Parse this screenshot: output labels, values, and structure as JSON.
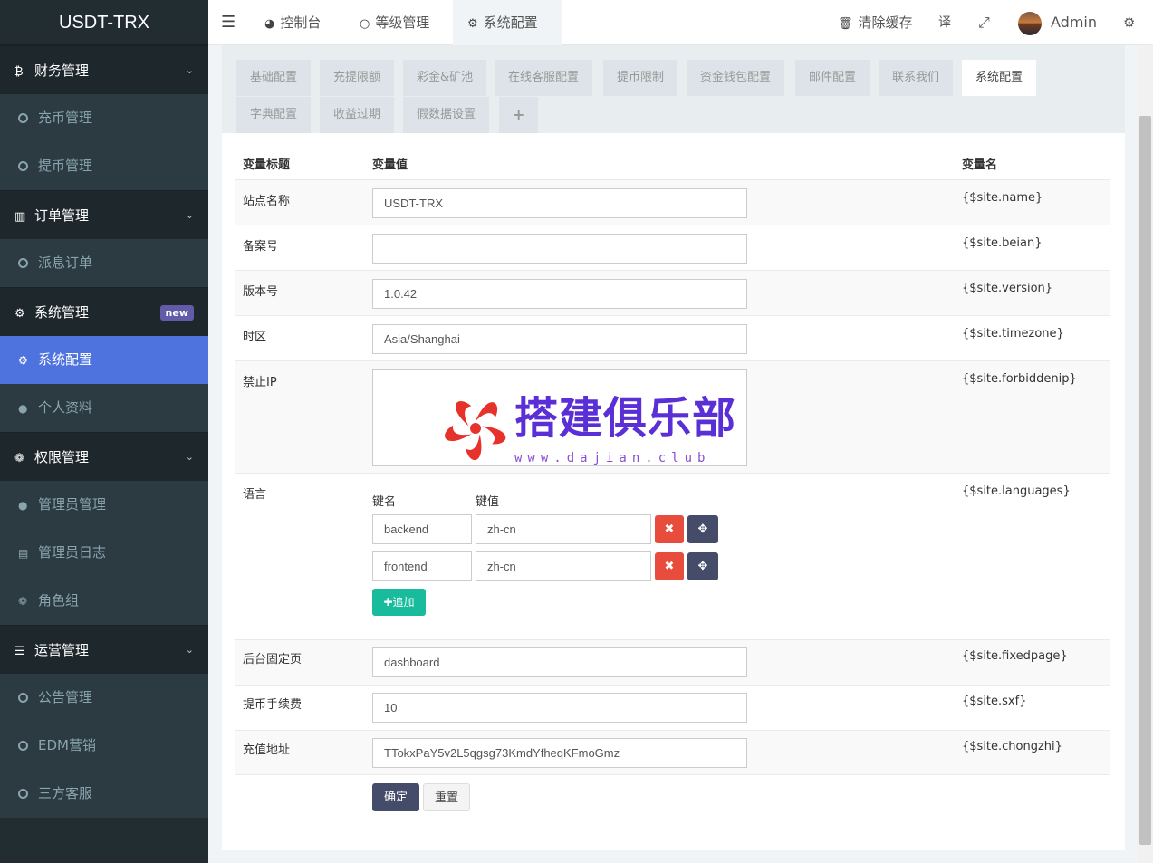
{
  "app": {
    "logo": "USDT-TRX"
  },
  "sidebar": [
    {
      "type": "header",
      "icon": "bitcoin-icon",
      "glyph": "₿",
      "label": "财务管理"
    },
    {
      "type": "item",
      "label": "充币管理"
    },
    {
      "type": "item",
      "label": "提币管理"
    },
    {
      "type": "header",
      "icon": "bar-chart-icon",
      "glyph": "▥",
      "label": "订单管理"
    },
    {
      "type": "item",
      "label": "派息订单"
    },
    {
      "type": "header",
      "icon": "gears-icon",
      "glyph": "⚙",
      "label": "系统管理",
      "badge": "new"
    },
    {
      "type": "item",
      "label": "系统配置",
      "active": true,
      "icon": "gear-icon"
    },
    {
      "type": "item",
      "label": "个人资料",
      "icon": "user-icon"
    },
    {
      "type": "header",
      "icon": "users-icon",
      "glyph": "👥",
      "label": "权限管理"
    },
    {
      "type": "item",
      "label": "管理员管理",
      "icon": "user-icon"
    },
    {
      "type": "item",
      "label": "管理员日志",
      "icon": "list-icon"
    },
    {
      "type": "item",
      "label": "角色组",
      "icon": "users-icon"
    },
    {
      "type": "header",
      "icon": "list-icon",
      "glyph": "☰",
      "label": "运营管理"
    },
    {
      "type": "item",
      "label": "公告管理"
    },
    {
      "type": "item",
      "label": "EDM营销"
    },
    {
      "type": "item",
      "label": "三方客服"
    }
  ],
  "topnav": {
    "tabs": [
      {
        "label": "控制台",
        "icon": "dashboard-icon"
      },
      {
        "label": "等级管理",
        "icon": "circle-icon"
      },
      {
        "label": "系统配置",
        "icon": "gear-icon",
        "active": true
      }
    ],
    "clear_cache": "清除缓存",
    "user": "Admin"
  },
  "config_tabs": [
    "基础配置",
    "充提限额",
    "彩金&矿池",
    "在线客服配置",
    "提币限制",
    "资金钱包配置",
    "邮件配置",
    "联系我们",
    "系统配置",
    "字典配置",
    "收益过期",
    "假数据设置",
    "+"
  ],
  "active_config_tab": "系统配置",
  "table": {
    "headers": {
      "title": "变量标题",
      "value": "变量值",
      "name": "变量名"
    },
    "rows": [
      {
        "label": "站点名称",
        "value": "USDT-TRX",
        "var": "{$site.name}"
      },
      {
        "label": "备案号",
        "value": "",
        "var": "{$site.beian}"
      },
      {
        "label": "版本号",
        "value": "1.0.42",
        "var": "{$site.version}"
      },
      {
        "label": "时区",
        "value": "Asia/Shanghai",
        "var": "{$site.timezone}"
      },
      {
        "label": "禁止IP",
        "value": "",
        "var": "{$site.forbiddenip}"
      },
      {
        "label": "语言",
        "var": "{$site.languages}"
      },
      {
        "label": "后台固定页",
        "value": "dashboard",
        "var": "{$site.fixedpage}"
      },
      {
        "label": "提币手续费",
        "value": "10",
        "var": "{$site.sxf}"
      },
      {
        "label": "充值地址",
        "value": "TTokxPaY5v2L5qgsg73KmdYfheqKFmoGmz",
        "var": "{$site.chongzhi}"
      }
    ]
  },
  "languages": {
    "key_header": "键名",
    "value_header": "键值",
    "entries": [
      {
        "key": "backend",
        "value": "zh-cn"
      },
      {
        "key": "frontend",
        "value": "zh-cn"
      }
    ],
    "add_label": "追加"
  },
  "buttons": {
    "ok": "确定",
    "reset": "重置"
  },
  "watermark": {
    "title": "搭建俱乐部",
    "url": "www.dajian.club"
  }
}
